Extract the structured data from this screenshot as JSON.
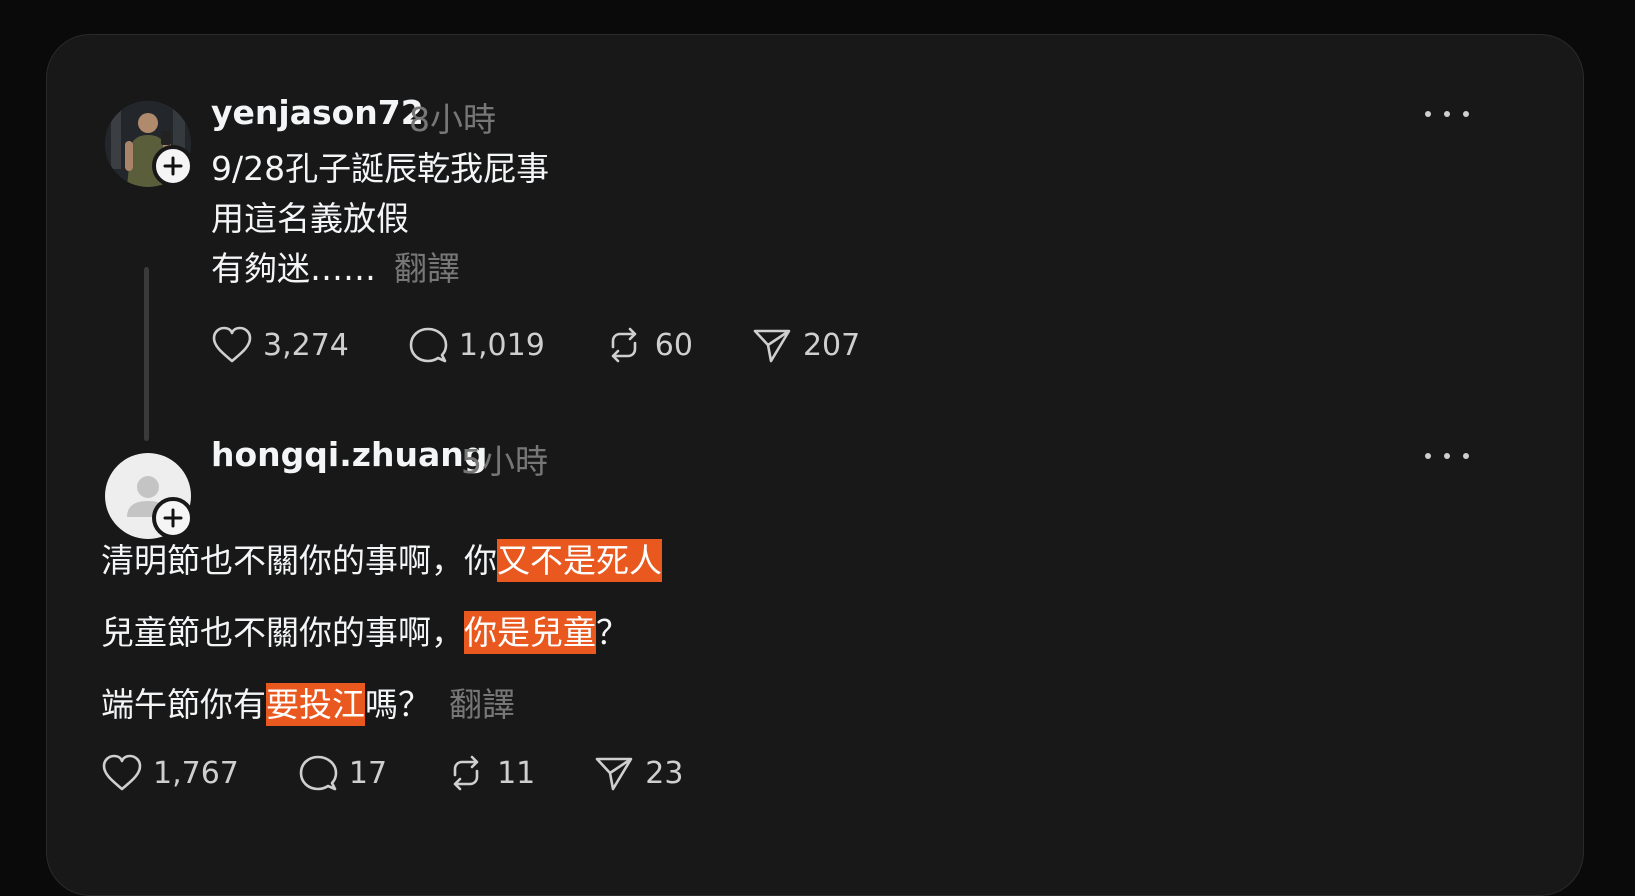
{
  "post": {
    "username": "yenjason72",
    "time": "8小時",
    "lines": [
      "9/28孔子誕辰乾我屁事",
      "用這名義放假",
      "有夠迷……"
    ],
    "translate": "翻譯",
    "likes": "3,274",
    "comments": "1,019",
    "reposts": "60",
    "shares": "207"
  },
  "reply": {
    "username": "hongqi.zhuang",
    "time": "5小時",
    "line1_a": "清明節也不關你的事啊，你",
    "line1_hl": "又不是死人",
    "line2_a": "兒童節也不關你的事啊，",
    "line2_hl": "你是兒童",
    "line2_b": "？",
    "line3_a": "端午節你有",
    "line3_hl": "要投江",
    "line3_b": "嗎？",
    "translate": "翻譯",
    "likes": "1,767",
    "comments": "17",
    "reposts": "11",
    "shares": "23"
  },
  "colors": {
    "background": "#0a0a0a",
    "card": "#181818",
    "highlight": "#e8581f",
    "muted": "#777777"
  }
}
